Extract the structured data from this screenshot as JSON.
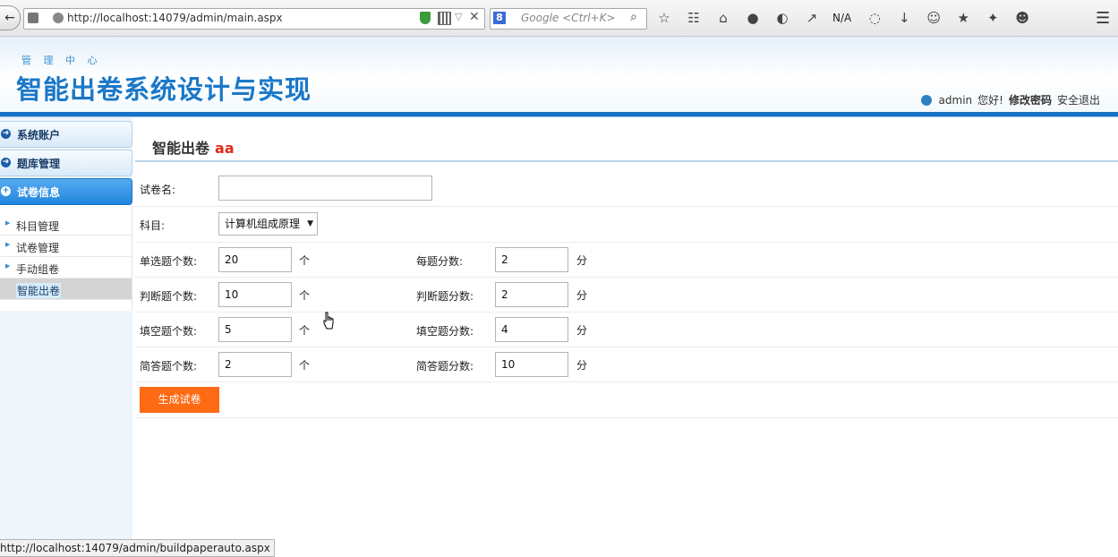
{
  "browser": {
    "url": "http://localhost:14079/admin/main.aspx",
    "search_placeholder": "Google <Ctrl+K>",
    "toolbar_na": "N/A"
  },
  "header": {
    "subtitle": "管 理 中 心",
    "title": "智能出卷系统设计与实现",
    "username": "admin",
    "greeting": "您好!",
    "change_password": "修改密码",
    "logout": "安全退出"
  },
  "sidebar": {
    "sections": [
      {
        "label": "系统账户",
        "icon": "arrow-circle-icon",
        "active": false
      },
      {
        "label": "题库管理",
        "icon": "arrow-circle-icon",
        "active": false
      },
      {
        "label": "试卷信息",
        "icon": "plus-circle-icon",
        "active": true
      }
    ],
    "items": [
      {
        "label": "科目管理"
      },
      {
        "label": "试卷管理"
      },
      {
        "label": "手动组卷"
      },
      {
        "label": "智能出卷",
        "active": true
      }
    ]
  },
  "main": {
    "title": "智能出卷",
    "title_user": "aa",
    "paper_name_label": "试卷名:",
    "paper_name_value": "",
    "subject_label": "科目:",
    "subject_value": "计算机组成原理",
    "rows": [
      {
        "count_label": "单选题个数:",
        "count_value": "20",
        "count_unit": "个",
        "score_label": "每题分数:",
        "score_value": "2",
        "score_unit": "分"
      },
      {
        "count_label": "判断题个数:",
        "count_value": "10",
        "count_unit": "个",
        "score_label": "判断题分数:",
        "score_value": "2",
        "score_unit": "分"
      },
      {
        "count_label": "填空题个数:",
        "count_value": "5",
        "count_unit": "个",
        "score_label": "填空题分数:",
        "score_value": "4",
        "score_unit": "分"
      },
      {
        "count_label": "简答题个数:",
        "count_value": "2",
        "count_unit": "个",
        "score_label": "简答题分数:",
        "score_value": "10",
        "score_unit": "分"
      }
    ],
    "generate_button": "生成试卷"
  },
  "statusbar": {
    "text": "http://localhost:14079/admin/buildpaperauto.aspx"
  },
  "colors": {
    "accent_blue": "#1772c6",
    "title_blue": "#1a78c8",
    "button_orange": "#ff6a14",
    "title_red": "#e02a1a"
  }
}
